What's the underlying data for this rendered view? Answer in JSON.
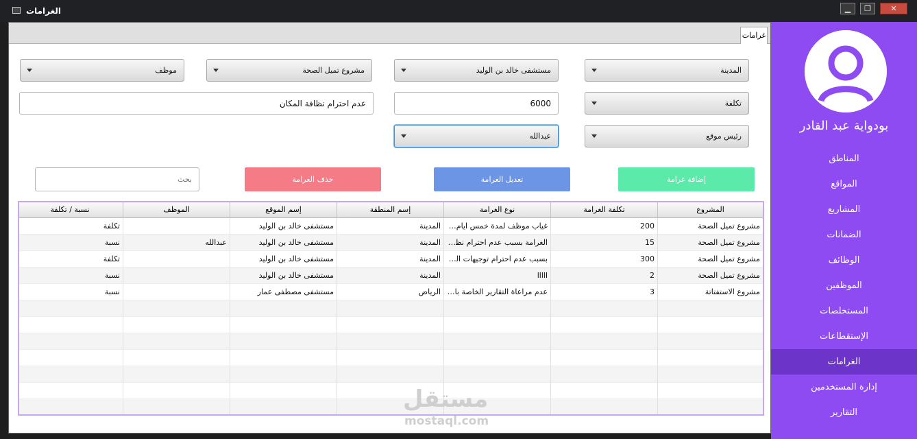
{
  "window": {
    "title": "الغرامات"
  },
  "tab": {
    "label": "غرامات"
  },
  "sidebar": {
    "username": "بودواية عبد القادر",
    "items": [
      {
        "label": "المناطق",
        "active": false
      },
      {
        "label": "المواقع",
        "active": false
      },
      {
        "label": "المشاريع",
        "active": false
      },
      {
        "label": "الضمانات",
        "active": false
      },
      {
        "label": "الوظائف",
        "active": false
      },
      {
        "label": "الموظفين",
        "active": false
      },
      {
        "label": "المستخلصات",
        "active": false
      },
      {
        "label": "الإستقطاعات",
        "active": false
      },
      {
        "label": "الغرامات",
        "active": true
      },
      {
        "label": "إدارة المستخدمين",
        "active": false
      },
      {
        "label": "التقارير",
        "active": false
      }
    ]
  },
  "form": {
    "region": "المدينة",
    "site": "مستشفى خالد بن الوليد",
    "project": "مشروع تميل الصحة",
    "employee": "موظف",
    "fine_type": "تكلفة",
    "amount": "6000",
    "description": "عدم احترام نظافة المكان",
    "site_manager": "رئيس موقع",
    "manager_name": "عبدالله"
  },
  "buttons": {
    "add": "إضافة غرامة",
    "edit": "تعديل الغرامة",
    "delete": "حذف الغرامة"
  },
  "search": {
    "placeholder": "بحث"
  },
  "table": {
    "columns": [
      "المشروع",
      "تكلفة الغرامة",
      "نوع الغرامة",
      "إسم المنطقة",
      "إسم الموقع",
      "الموظف",
      "نسبة / تكلفة"
    ],
    "rows": [
      [
        "مشروع تميل الصحة",
        "200",
        "غياب موظف لمدة خمس ايام بدون ...",
        "المدينة",
        "مستشفى خالد بن الوليد",
        "",
        "تكلفة"
      ],
      [
        "مشروع تميل الصحة",
        "15",
        "الغرامة بسبب عدم احترام نظافة تيا...",
        "المدينة",
        "مستشفى خالد بن الوليد",
        "عبدالله",
        "نسبة"
      ],
      [
        "مشروع تميل الصحة",
        "300",
        "بسبب عدم احترام توجيهات المدير",
        "المدينة",
        "مستشفى خالد بن الوليد",
        "",
        "تكلفة"
      ],
      [
        "مشروع تميل الصحة",
        "2",
        "lllll",
        "المدينة",
        "مستشفى خالد بن الوليد",
        "",
        "نسبة"
      ],
      [
        "مشروع الاستفتاتة",
        "3",
        "عدم مراعاة التقارير الخاصة بالعمل",
        "الرياض",
        "مستشفى مصطفى عمار",
        "",
        "نسبة"
      ],
      [
        "",
        "",
        "",
        "",
        "",
        "",
        ""
      ],
      [
        "",
        "",
        "",
        "",
        "",
        "",
        ""
      ],
      [
        "",
        "",
        "",
        "",
        "",
        "",
        ""
      ],
      [
        "",
        "",
        "",
        "",
        "",
        "",
        ""
      ],
      [
        "",
        "",
        "",
        "",
        "",
        "",
        ""
      ],
      [
        "",
        "",
        "",
        "",
        "",
        "",
        ""
      ],
      [
        "",
        "",
        "",
        "",
        "",
        "",
        ""
      ]
    ]
  },
  "watermark": {
    "arabic": "مستقل",
    "latin": "mostaql.com"
  },
  "colors": {
    "sidebar": "#8e4bf2",
    "sidebar_active": "#6c34c8",
    "add": "#5ceaaa",
    "edit": "#6d95e6",
    "delete": "#f57c86"
  }
}
